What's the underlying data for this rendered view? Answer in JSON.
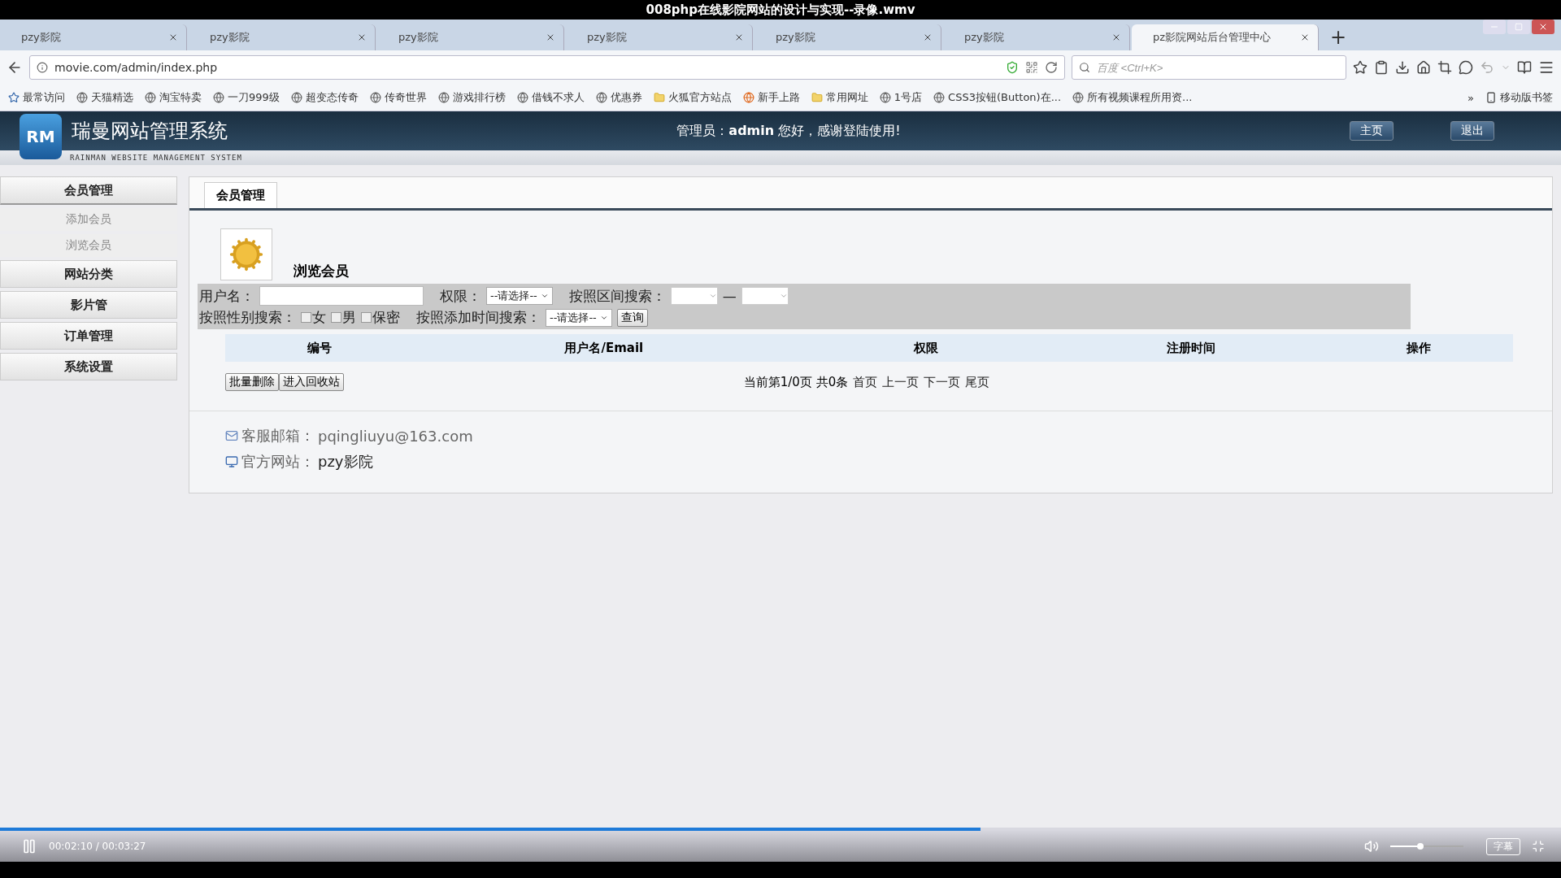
{
  "video": {
    "title": "008php在线影院网站的设计与实现--录像.wmv",
    "time": "00:02:10 / 00:03:27",
    "progress": {
      "level": 0.628
    },
    "volume": {
      "level": 0.41
    },
    "subtitle_button": "字幕"
  },
  "browser": {
    "tabs": [
      {
        "label": "pzy影院",
        "selected": false
      },
      {
        "label": "pzy影院",
        "selected": false
      },
      {
        "label": "pzy影院",
        "selected": false
      },
      {
        "label": "pzy影院",
        "selected": false
      },
      {
        "label": "pzy影院",
        "selected": false
      },
      {
        "label": "pzy影院",
        "selected": false
      },
      {
        "label": "pz影院网站后台管理中心",
        "selected": true
      }
    ],
    "new_tab": "+",
    "url": "movie.com/admin/index.php",
    "search": {
      "placeholder": "百度 <Ctrl+K>"
    },
    "bookmarks": [
      {
        "label": "最常访问",
        "kind": "star"
      },
      {
        "label": "天猫精选",
        "kind": "globe"
      },
      {
        "label": "淘宝特卖",
        "kind": "globe"
      },
      {
        "label": "一刀999级",
        "kind": "globe"
      },
      {
        "label": "超变态传奇",
        "kind": "globe"
      },
      {
        "label": "传奇世界",
        "kind": "globe"
      },
      {
        "label": "游戏排行榜",
        "kind": "globe"
      },
      {
        "label": "借钱不求人",
        "kind": "globe"
      },
      {
        "label": "优惠券",
        "kind": "globe"
      },
      {
        "label": "火狐官方站点",
        "kind": "folder"
      },
      {
        "label": "新手上路",
        "kind": "fox"
      },
      {
        "label": "常用网址",
        "kind": "folder"
      },
      {
        "label": "1号店",
        "kind": "globe"
      },
      {
        "label": "CSS3按钮(Button)在...",
        "kind": "globe"
      },
      {
        "label": "所有视频课程所用资...",
        "kind": "globe"
      }
    ],
    "more": "»",
    "mobile_bookmarks": "移动版书签"
  },
  "header": {
    "logo_text": "RM",
    "title": "瑞曼网站管理系统",
    "subtitle": "RAINMAN WEBSITE MANAGEMENT SYSTEM",
    "greeting": "管理员：**admin** 您好，感谢登陆使用!",
    "buttons": [
      "主页",
      "退出"
    ]
  },
  "sidebar": {
    "items": [
      {
        "label": "会员管理",
        "expanded": true,
        "children": [
          {
            "label": "添加会员"
          },
          {
            "label": "浏览会员"
          }
        ]
      },
      {
        "label": "网站分类",
        "expanded": false
      },
      {
        "label": "影片管",
        "expanded": false
      },
      {
        "label": "订单管理",
        "expanded": false
      },
      {
        "label": "系统设置",
        "expanded": false
      }
    ]
  },
  "content": {
    "tab": "会员管理",
    "heading": "浏览会员",
    "filters": {
      "username_label": "用户名：",
      "role_label": "权限：",
      "role_select": "--请选择--",
      "range_label": "按照区间搜索：",
      "range_sep": "—",
      "gender_label": "按照性别搜索：",
      "genders": [
        {
          "label": "女",
          "checked": false
        },
        {
          "label": "男",
          "checked": false
        },
        {
          "label": "保密",
          "checked": false
        }
      ],
      "time_label": "按照添加时间搜索：",
      "time_select": "--请选择--",
      "query_button": "查询"
    },
    "table": {
      "columns": [
        "编号",
        "用户名/Email",
        "权限",
        "注册时间",
        "操作"
      ]
    },
    "actions": [
      "批量删除",
      "进入回收站"
    ],
    "pagination": {
      "info": "当前第1/0页 共0条",
      "links": [
        "首页",
        "上一页",
        "下一页",
        "尾页"
      ]
    },
    "footer": [
      {
        "kind": "mail",
        "label": "客服邮箱：",
        "value": "pqingliuyu@163.com"
      },
      {
        "kind": "site",
        "label": "官方网站：",
        "value": "pzy影院"
      }
    ]
  }
}
